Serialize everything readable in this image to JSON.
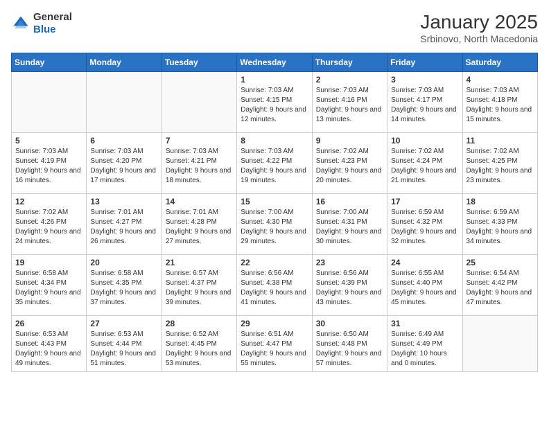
{
  "header": {
    "logo_line1": "General",
    "logo_line2": "Blue",
    "month": "January 2025",
    "location": "Srbinovo, North Macedonia"
  },
  "weekdays": [
    "Sunday",
    "Monday",
    "Tuesday",
    "Wednesday",
    "Thursday",
    "Friday",
    "Saturday"
  ],
  "weeks": [
    [
      {
        "day": "",
        "info": ""
      },
      {
        "day": "",
        "info": ""
      },
      {
        "day": "",
        "info": ""
      },
      {
        "day": "1",
        "info": "Sunrise: 7:03 AM\nSunset: 4:15 PM\nDaylight: 9 hours and 12 minutes."
      },
      {
        "day": "2",
        "info": "Sunrise: 7:03 AM\nSunset: 4:16 PM\nDaylight: 9 hours and 13 minutes."
      },
      {
        "day": "3",
        "info": "Sunrise: 7:03 AM\nSunset: 4:17 PM\nDaylight: 9 hours and 14 minutes."
      },
      {
        "day": "4",
        "info": "Sunrise: 7:03 AM\nSunset: 4:18 PM\nDaylight: 9 hours and 15 minutes."
      }
    ],
    [
      {
        "day": "5",
        "info": "Sunrise: 7:03 AM\nSunset: 4:19 PM\nDaylight: 9 hours and 16 minutes."
      },
      {
        "day": "6",
        "info": "Sunrise: 7:03 AM\nSunset: 4:20 PM\nDaylight: 9 hours and 17 minutes."
      },
      {
        "day": "7",
        "info": "Sunrise: 7:03 AM\nSunset: 4:21 PM\nDaylight: 9 hours and 18 minutes."
      },
      {
        "day": "8",
        "info": "Sunrise: 7:03 AM\nSunset: 4:22 PM\nDaylight: 9 hours and 19 minutes."
      },
      {
        "day": "9",
        "info": "Sunrise: 7:02 AM\nSunset: 4:23 PM\nDaylight: 9 hours and 20 minutes."
      },
      {
        "day": "10",
        "info": "Sunrise: 7:02 AM\nSunset: 4:24 PM\nDaylight: 9 hours and 21 minutes."
      },
      {
        "day": "11",
        "info": "Sunrise: 7:02 AM\nSunset: 4:25 PM\nDaylight: 9 hours and 23 minutes."
      }
    ],
    [
      {
        "day": "12",
        "info": "Sunrise: 7:02 AM\nSunset: 4:26 PM\nDaylight: 9 hours and 24 minutes."
      },
      {
        "day": "13",
        "info": "Sunrise: 7:01 AM\nSunset: 4:27 PM\nDaylight: 9 hours and 26 minutes."
      },
      {
        "day": "14",
        "info": "Sunrise: 7:01 AM\nSunset: 4:28 PM\nDaylight: 9 hours and 27 minutes."
      },
      {
        "day": "15",
        "info": "Sunrise: 7:00 AM\nSunset: 4:30 PM\nDaylight: 9 hours and 29 minutes."
      },
      {
        "day": "16",
        "info": "Sunrise: 7:00 AM\nSunset: 4:31 PM\nDaylight: 9 hours and 30 minutes."
      },
      {
        "day": "17",
        "info": "Sunrise: 6:59 AM\nSunset: 4:32 PM\nDaylight: 9 hours and 32 minutes."
      },
      {
        "day": "18",
        "info": "Sunrise: 6:59 AM\nSunset: 4:33 PM\nDaylight: 9 hours and 34 minutes."
      }
    ],
    [
      {
        "day": "19",
        "info": "Sunrise: 6:58 AM\nSunset: 4:34 PM\nDaylight: 9 hours and 35 minutes."
      },
      {
        "day": "20",
        "info": "Sunrise: 6:58 AM\nSunset: 4:35 PM\nDaylight: 9 hours and 37 minutes."
      },
      {
        "day": "21",
        "info": "Sunrise: 6:57 AM\nSunset: 4:37 PM\nDaylight: 9 hours and 39 minutes."
      },
      {
        "day": "22",
        "info": "Sunrise: 6:56 AM\nSunset: 4:38 PM\nDaylight: 9 hours and 41 minutes."
      },
      {
        "day": "23",
        "info": "Sunrise: 6:56 AM\nSunset: 4:39 PM\nDaylight: 9 hours and 43 minutes."
      },
      {
        "day": "24",
        "info": "Sunrise: 6:55 AM\nSunset: 4:40 PM\nDaylight: 9 hours and 45 minutes."
      },
      {
        "day": "25",
        "info": "Sunrise: 6:54 AM\nSunset: 4:42 PM\nDaylight: 9 hours and 47 minutes."
      }
    ],
    [
      {
        "day": "26",
        "info": "Sunrise: 6:53 AM\nSunset: 4:43 PM\nDaylight: 9 hours and 49 minutes."
      },
      {
        "day": "27",
        "info": "Sunrise: 6:53 AM\nSunset: 4:44 PM\nDaylight: 9 hours and 51 minutes."
      },
      {
        "day": "28",
        "info": "Sunrise: 6:52 AM\nSunset: 4:45 PM\nDaylight: 9 hours and 53 minutes."
      },
      {
        "day": "29",
        "info": "Sunrise: 6:51 AM\nSunset: 4:47 PM\nDaylight: 9 hours and 55 minutes."
      },
      {
        "day": "30",
        "info": "Sunrise: 6:50 AM\nSunset: 4:48 PM\nDaylight: 9 hours and 57 minutes."
      },
      {
        "day": "31",
        "info": "Sunrise: 6:49 AM\nSunset: 4:49 PM\nDaylight: 10 hours and 0 minutes."
      },
      {
        "day": "",
        "info": ""
      }
    ]
  ]
}
